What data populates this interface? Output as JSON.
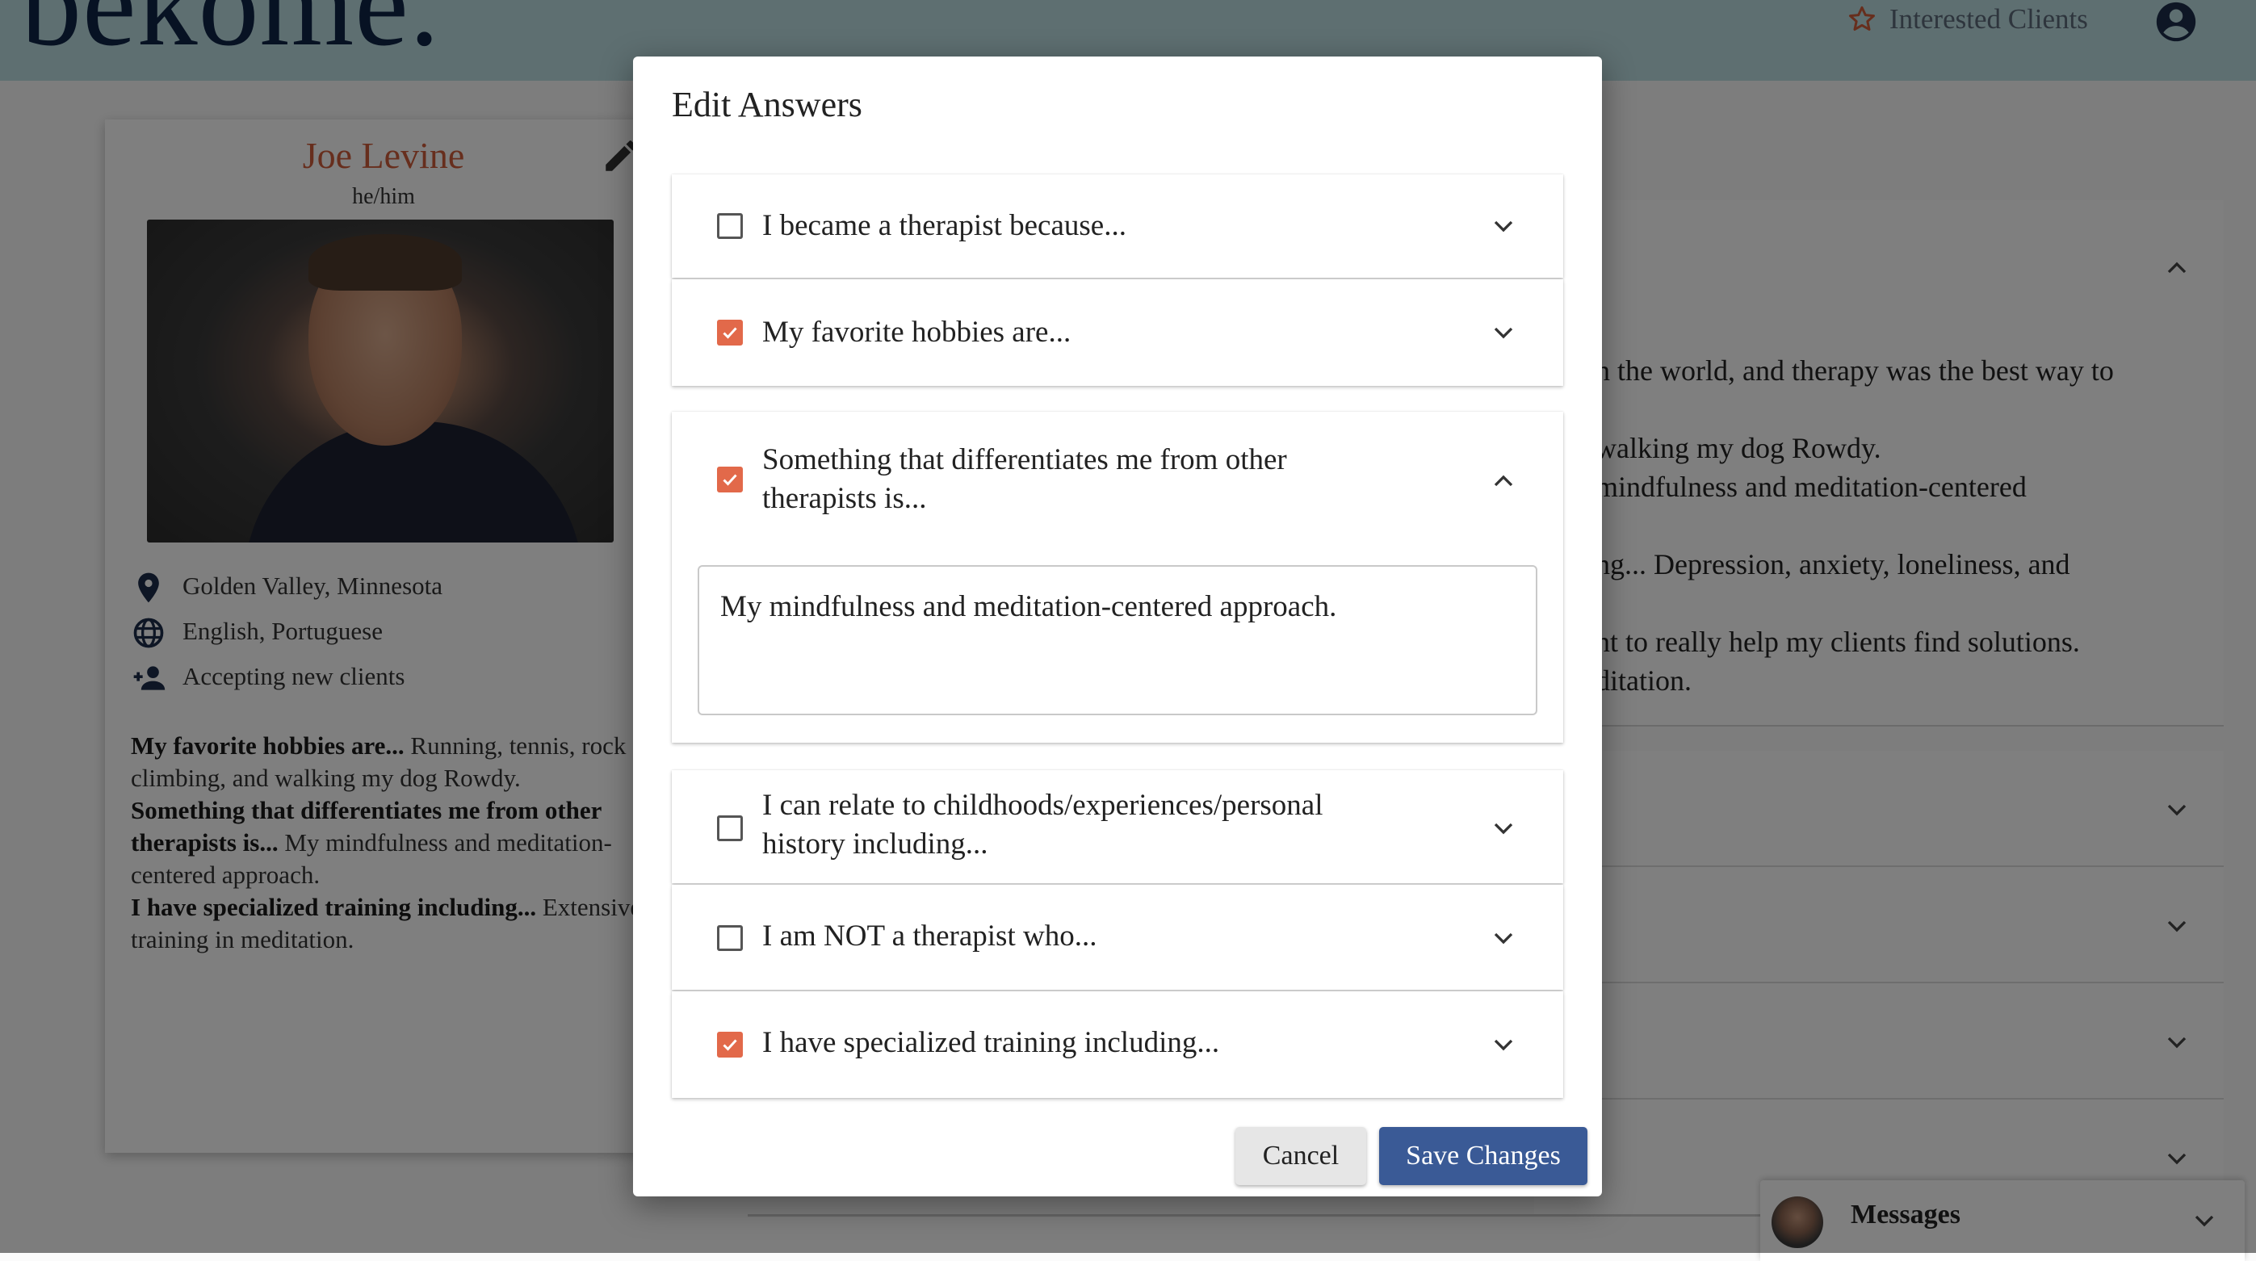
{
  "header": {
    "logo": "bekome.",
    "interested_label": "Interested Clients"
  },
  "profile": {
    "name": "Joe Levine",
    "pronouns": "he/him",
    "location": "Golden Valley, Minnesota",
    "languages": "English, Portuguese",
    "status": "Accepting new clients",
    "bio": [
      {
        "q": "My favorite hobbies are...",
        "a": " Running, tennis, rock climbing, and walking my dog Rowdy."
      },
      {
        "q": "Something that differentiates me from other therapists is...",
        "a": " My mindfulness and meditation-centered approach."
      },
      {
        "q": "I have specialized training including...",
        "a": " Extensive training in meditation."
      }
    ]
  },
  "background_panel": {
    "lines": [
      "n the world, and therapy was the best way to",
      "walking my dog Rowdy.",
      "mindfulness and meditation-centered",
      "ng... Depression, anxiety, loneliness, and",
      "nt to really help my clients find solutions.",
      "ditation."
    ]
  },
  "messages": {
    "label": "Messages"
  },
  "dialog": {
    "title": "Edit Answers",
    "items": [
      {
        "label": "I became a therapist because...",
        "checked": false,
        "expanded": false
      },
      {
        "label": "My favorite hobbies are...",
        "checked": true,
        "expanded": false
      },
      {
        "label": "Something that differentiates me from other therapists is...",
        "checked": true,
        "expanded": true,
        "answer": "My mindfulness and meditation-centered approach."
      },
      {
        "label": "I can relate to childhoods/experiences/personal history including...",
        "checked": false,
        "expanded": false
      },
      {
        "label": "I am NOT a therapist who...",
        "checked": false,
        "expanded": false
      },
      {
        "label": "I have specialized training including...",
        "checked": true,
        "expanded": false
      }
    ],
    "cancel_label": "Cancel",
    "save_label": "Save Changes"
  },
  "colors": {
    "accent": "#e2694a",
    "primary_button": "#3a5a96",
    "header_bg": "#bddfe2",
    "name": "#ce5c3a"
  }
}
